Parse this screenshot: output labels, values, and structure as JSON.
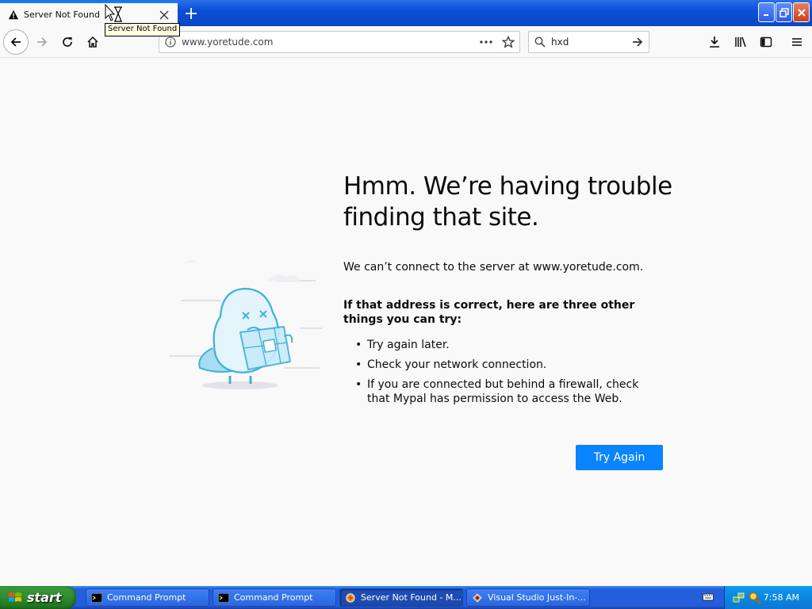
{
  "tab": {
    "title": "Server Not Found"
  },
  "tooltip": {
    "text": "Server Not Found"
  },
  "navbar": {
    "url": "www.yoretude.com",
    "search_value": "hxd"
  },
  "error": {
    "title": "Hmm. We’re having trouble finding that site.",
    "intro": "We can’t connect to the server at www.yoretude.com.",
    "suggestion_heading": "If that address is correct, here are three other things you can try:",
    "suggestions": [
      "Try again later.",
      "Check your network connection.",
      "If you are connected but behind a firewall, check that Mypal has permission to access the Web."
    ],
    "button_label": "Try Again"
  },
  "taskbar": {
    "start_label": "start",
    "tasks": [
      {
        "label": "Command Prompt",
        "icon": "cmd-icon"
      },
      {
        "label": "Command Prompt",
        "icon": "cmd-icon"
      },
      {
        "label": "Server Not Found - M...",
        "icon": "mypal-icon"
      },
      {
        "label": "Visual Studio Just-In-...",
        "icon": "visual-studio-icon"
      }
    ],
    "clock": "7:58 AM"
  },
  "colors": {
    "accent": "#0a84ff",
    "taskbar": "#245edb",
    "start": "#2f8c2f"
  }
}
